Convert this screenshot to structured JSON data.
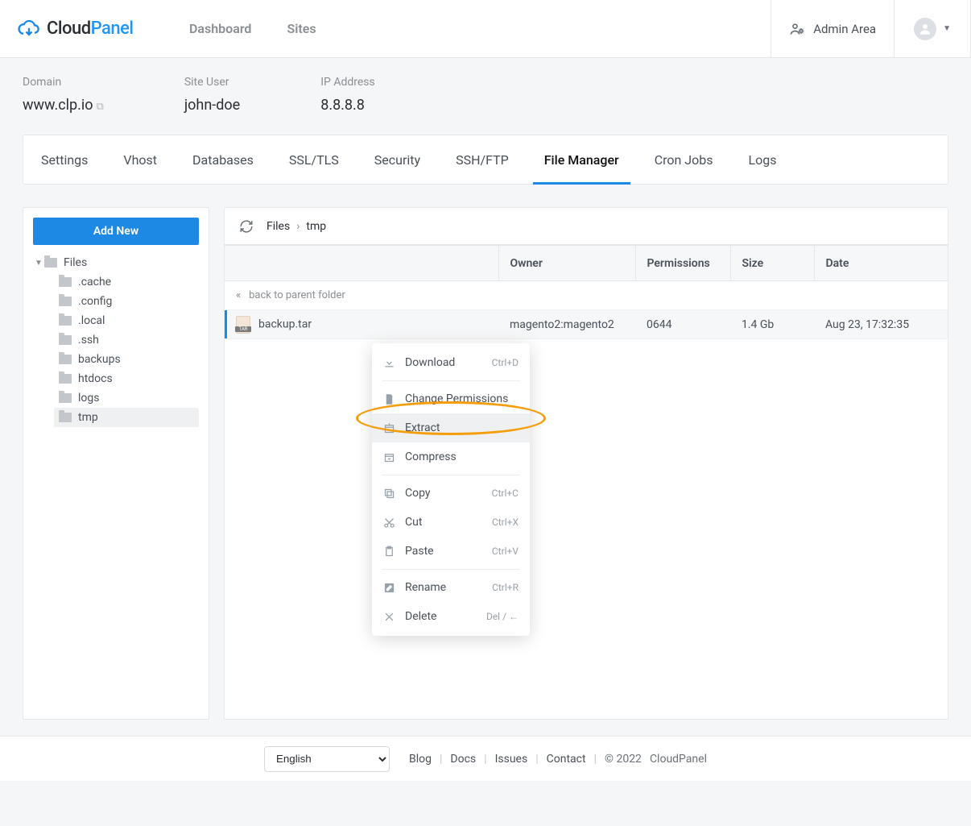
{
  "brand": {
    "name1": "Cloud",
    "name2": "Panel"
  },
  "nav": {
    "dashboard": "Dashboard",
    "sites": "Sites",
    "admin": "Admin Area"
  },
  "site": {
    "domain_label": "Domain",
    "domain_value": "www.clp.io",
    "user_label": "Site User",
    "user_value": "john-doe",
    "ip_label": "IP Address",
    "ip_value": "8.8.8.8"
  },
  "tabs": [
    "Settings",
    "Vhost",
    "Databases",
    "SSL/TLS",
    "Security",
    "SSH/FTP",
    "File Manager",
    "Cron Jobs",
    "Logs"
  ],
  "active_tab": "File Manager",
  "sidebar": {
    "add_label": "Add New",
    "root": "Files",
    "children": [
      ".cache",
      ".config",
      ".local",
      ".ssh",
      "backups",
      "htdocs",
      "logs",
      "tmp"
    ],
    "selected": "tmp"
  },
  "breadcrumb": [
    "Files",
    "tmp"
  ],
  "columns": {
    "name": "",
    "owner": "Owner",
    "perm": "Permissions",
    "size": "Size",
    "date": "Date"
  },
  "back_row": "back to parent folder",
  "file_row": {
    "name": "backup.tar",
    "owner": "magento2:magento2",
    "perm": "0644",
    "size": "1.4 Gb",
    "date": "Aug 23, 17:32:35"
  },
  "ctx": {
    "download": "Download",
    "download_k": "Ctrl+D",
    "chperm": "Change Permissions",
    "extract": "Extract",
    "compress": "Compress",
    "copy": "Copy",
    "copy_k": "Ctrl+C",
    "cut": "Cut",
    "cut_k": "Ctrl+X",
    "paste": "Paste",
    "paste_k": "Ctrl+V",
    "rename": "Rename",
    "rename_k": "Ctrl+R",
    "delete": "Delete",
    "delete_k": "Del / ←"
  },
  "footer": {
    "lang": "English",
    "links": [
      "Blog",
      "Docs",
      "Issues",
      "Contact"
    ],
    "copyright": "© 2022",
    "product": "CloudPanel"
  }
}
